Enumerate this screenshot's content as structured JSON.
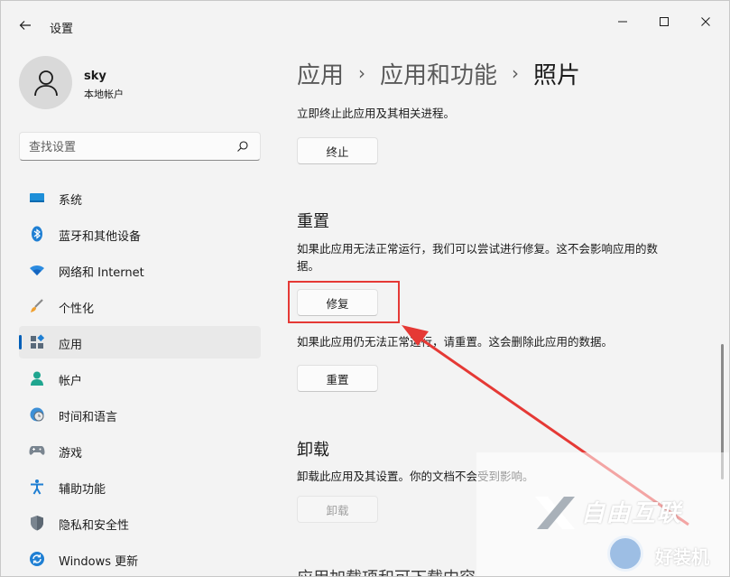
{
  "window": {
    "title": "设置"
  },
  "user": {
    "name": "sky",
    "account_type": "本地帐户"
  },
  "search": {
    "placeholder": "查找设置"
  },
  "sidebar": {
    "items": [
      {
        "label": "系统",
        "icon": "system-icon"
      },
      {
        "label": "蓝牙和其他设备",
        "icon": "bluetooth-icon"
      },
      {
        "label": "网络和 Internet",
        "icon": "wifi-icon"
      },
      {
        "label": "个性化",
        "icon": "brush-icon"
      },
      {
        "label": "应用",
        "icon": "apps-icon",
        "selected": true
      },
      {
        "label": "帐户",
        "icon": "account-icon"
      },
      {
        "label": "时间和语言",
        "icon": "clock-globe-icon"
      },
      {
        "label": "游戏",
        "icon": "gamepad-icon"
      },
      {
        "label": "辅助功能",
        "icon": "accessibility-icon"
      },
      {
        "label": "隐私和安全性",
        "icon": "shield-icon"
      },
      {
        "label": "Windows 更新",
        "icon": "update-icon"
      }
    ]
  },
  "breadcrumb": {
    "level1": "应用",
    "level2": "应用和功能",
    "current": "照片",
    "separator": "›"
  },
  "terminate": {
    "description": "立即终止此应用及其相关进程。",
    "button": "终止"
  },
  "reset": {
    "title": "重置",
    "repair_desc_line1": "如果此应用无法正常运行，我们可以尝试进行修复。这不会影响应用的数",
    "repair_desc_line2": "据。",
    "repair_button": "修复",
    "reset_desc": "如果此应用仍无法正常运行，请重置。这会删除此应用的数据。",
    "reset_button": "重置"
  },
  "uninstall": {
    "title": "卸载",
    "description": "卸载此应用及其设置。你的文档不会受到影响。",
    "button": "卸载"
  },
  "partial_heading": "应用加载项和可下载内容",
  "watermark": {
    "brand1": "自由互联",
    "brand2": "好装机"
  },
  "colors": {
    "accent": "#005fb8",
    "annotation": "#e53935"
  }
}
